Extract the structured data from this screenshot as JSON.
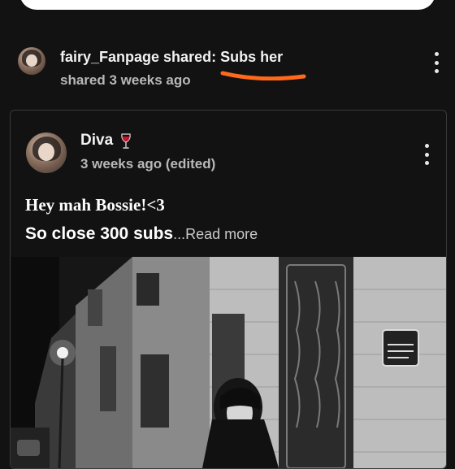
{
  "share": {
    "sharer_name": "fairy_Fanpage",
    "shared_word": " shared: ",
    "shared_title": "Subs her",
    "shared_time": "shared 3 weeks ago",
    "underline_color": "#ff6a1a"
  },
  "post": {
    "author_name": "Diva",
    "author_icon": "wine-glass-icon",
    "time": "3 weeks ago (edited)",
    "line1": "Hey mah Bossie!<3",
    "line2": "So close 300 subs",
    "read_more": "...Read more",
    "photo_icon": "street-photo"
  }
}
